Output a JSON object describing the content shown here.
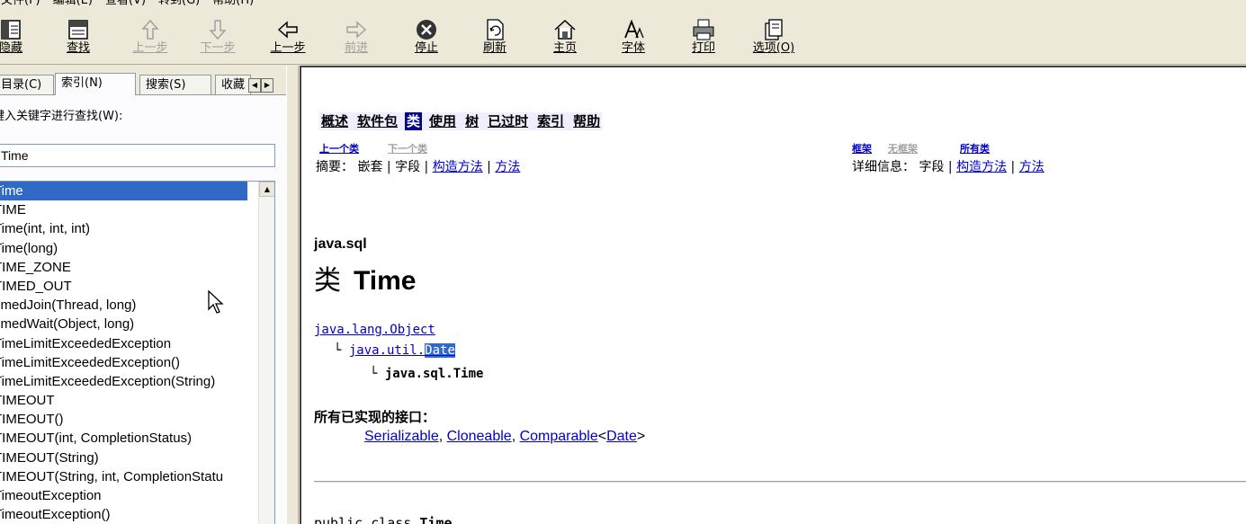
{
  "menu": [
    "文件(F)",
    "编辑(E)",
    "查看(V)",
    "转到(G)",
    "帮助(H)"
  ],
  "toolbar": {
    "hide": "隐藏",
    "find": "查找",
    "up": "上一步",
    "down": "下一步",
    "back": "上一步",
    "forward": "前进",
    "stop": "停止",
    "refresh": "刷新",
    "home": "主页",
    "font": "字体",
    "print": "打印",
    "options": "选项(O)"
  },
  "tabs": {
    "contents": "目录(C)",
    "index": "索引(N)",
    "search": "搜索(S)",
    "favorites": "收藏"
  },
  "index_panel": {
    "label": "键入关键字进行查找(W):",
    "input_value": "Time",
    "items": [
      "Time",
      "TIME",
      "Time(int, int, int)",
      "Time(long)",
      "TIME_ZONE",
      "TIMED_OUT",
      "timedJoin(Thread, long)",
      "timedWait(Object, long)",
      "TimeLimitExceededException",
      "TimeLimitExceededException()",
      "TimeLimitExceededException(String)",
      "TIMEOUT",
      "TIMEOUT()",
      "TIMEOUT(int, CompletionStatus)",
      "TIMEOUT(String)",
      "TIMEOUT(String, int, CompletionStatu",
      "TimeoutException",
      "TimeoutException()"
    ],
    "selected_index": 0
  },
  "doc": {
    "navbar": [
      "概述",
      "软件包",
      "类",
      "使用",
      "树",
      "已过时",
      "索引",
      "帮助"
    ],
    "nav_current": "类",
    "prev_class": "上一个类",
    "next_class": "下一个类",
    "frames": "框架",
    "no_frames": "无框架",
    "all_classes": "所有类",
    "summary_label": "摘要：",
    "summary_nested": "嵌套",
    "summary_field": "字段",
    "summary_constr": "构造方法",
    "summary_method": "方法",
    "detail_label": "详细信息：",
    "detail_field": "字段",
    "detail_constr": "构造方法",
    "detail_method": "方法",
    "sep": "|",
    "package": "java.sql",
    "class_kw": "类",
    "class_name": "Time",
    "tree_object": "java.lang.Object",
    "tree_util_prefix": "java.util.",
    "tree_util_date": "Date",
    "tree_self": "java.sql.Time",
    "ifaces_title": "所有已实现的接口：",
    "iface1": "Serializable",
    "iface2": "Cloneable",
    "iface3": "Comparable",
    "iface3_lt": "<",
    "iface3_param": "Date",
    "iface3_gt": ">",
    "comma": ",",
    "decl_prefix": "public class",
    "decl_name": "Time"
  },
  "colors": {
    "selection": "#316ac5",
    "link": "#0000cc",
    "nav_current_bg": "#00008b"
  }
}
